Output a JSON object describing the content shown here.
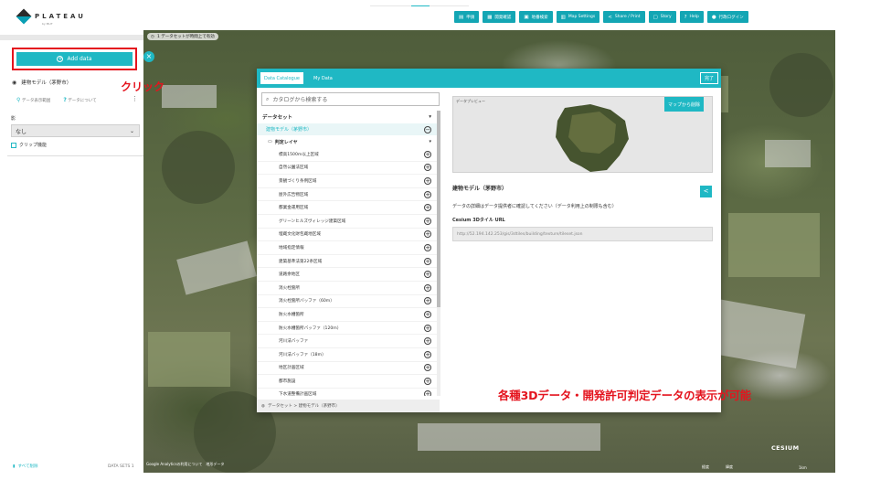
{
  "app": {
    "logo": "PLATEAU",
    "logo_sub": "by MLIT"
  },
  "sidebar": {
    "add_data_label": "Add data",
    "dataset_name": "建物モデル（茅野市）",
    "dataset_actions": [
      "データ表示範囲",
      "データについて"
    ],
    "shadow_label": "影",
    "shadow_value": "なし",
    "clip_label": "クリップ機能",
    "clear_all": "すべて削除",
    "datasets_count": "DATA SETS 1"
  },
  "toolbar": {
    "buttons": [
      "申請",
      "開発確認",
      "地番検索",
      "Map Settings",
      "Share / Print",
      "Story",
      "Help",
      "行政ログイン"
    ]
  },
  "map": {
    "status": "1 データセットが時間上で有効",
    "footer_links": [
      "Google Analyticsの利用について",
      "地形データ"
    ],
    "cesium": "CESIUM",
    "coords": [
      "経度",
      "緯度"
    ],
    "scale": "1km"
  },
  "annotations": {
    "click": "クリック",
    "main": "各種3Dデータ・開発許可判定データの表示が可能"
  },
  "modal": {
    "tabs": [
      "Data Catalogue",
      "My Data"
    ],
    "done": "完了",
    "search_placeholder": "カタログから検索する",
    "section": "データセット",
    "selected_dataset": "建物モデル（茅野市）",
    "folder": "判定レイヤ",
    "items": [
      "標高1500m以上区域",
      "自然公園法区域",
      "景観づくり条例区域",
      "屋外広告物区域",
      "都業金運用区域",
      "グリーンヒルズヴィレッジ建築区域",
      "埋蔵文化財包蔵地区域",
      "地域指定情報",
      "建築基準法第22条区域",
      "道路余地区",
      "消火栓箇所",
      "消火栓箇所バッファ（60m）",
      "防火水槽箇所",
      "防火水槽箇所バッファ（120m）",
      "河川法バッファ",
      "河川法バッファ（18m）",
      "地区計画区域",
      "都市施設",
      "下水道整備計画区域"
    ],
    "breadcrumb": "データセット > 建物モデル（茅野市）",
    "preview_label": "データプレビュー",
    "remove_btn": "マップから削除",
    "detail_title": "建物モデル（茅野市）",
    "detail_desc": "データの詳細はデータ提供者に確認してください（データ利用上の制限も含む）",
    "detail_sub": "Cesium 3Dタイル URL",
    "url": "http://52.194.142.253/gis/3dtiles/building/texture/tileset.json"
  },
  "colors": {
    "accent": "#1fb8c4",
    "annotation": "#e4141e"
  }
}
